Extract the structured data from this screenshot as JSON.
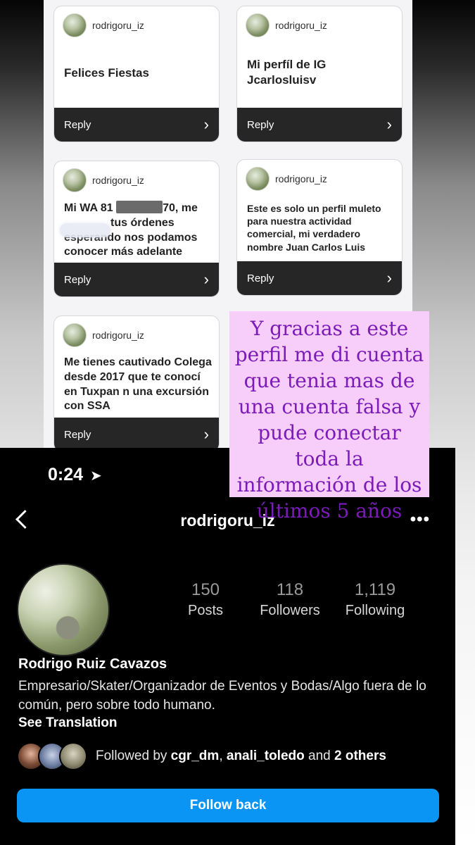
{
  "comments": [
    {
      "user": "rodrigoru_iz",
      "message": "Felices Fiestas",
      "reply": "Reply"
    },
    {
      "user": "rodrigoru_iz",
      "message": "Mi perfíl de IG Jcarlosluisv",
      "reply": "Reply"
    },
    {
      "user": "rodrigoru_iz",
      "message_line1_start": "Mi WA 81",
      "message_line1_end": "70, me",
      "message_rest": "tus órdenes esperando nos podamos conocer más adelante",
      "reply": "Reply"
    },
    {
      "user": "rodrigoru_iz",
      "message": "Este es solo un perfil muleto para nuestra actividad comercial, mi verdadero nombre Juan Carlos Luis",
      "reply": "Reply"
    },
    {
      "user": "rodrigoru_iz",
      "message": "Me tienes cautivado Colega desde 2017 que te conocí en Tuxpan n una excursión con SSA",
      "reply": "Reply"
    }
  ],
  "overlay_note": "Y gracias a este perfil me di cuenta que tenia mas de una cuenta falsa y pude conectar toda la información de los últimos 5 años",
  "profile": {
    "status_time": "0:24",
    "username": "rodrigoru_iz",
    "more": "•••",
    "stats": {
      "posts_count": "150",
      "posts_label": "Posts",
      "followers_count": "118",
      "followers_label": "Followers",
      "following_count": "1,119",
      "following_label": "Following"
    },
    "full_name": "Rodrigo Ruiz Cavazos",
    "bio": "Empresario/Skater/Organizador de Eventos y Bodas/Algo fuera de lo común, pero sobre todo humano.",
    "see_translation": "See Translation",
    "followed_by_prefix": "Followed by ",
    "followed_user1": "cgr_dm",
    "followed_sep": ", ",
    "followed_user2": "anali_toledo",
    "followed_and": " and ",
    "followed_others": "2 others",
    "follow_back": "Follow back"
  },
  "colors": {
    "accent_button": "#0a95f5",
    "overlay_bg": "#f7cdf9",
    "overlay_text": "#7b1bb8",
    "reply_bar": "#262626"
  }
}
